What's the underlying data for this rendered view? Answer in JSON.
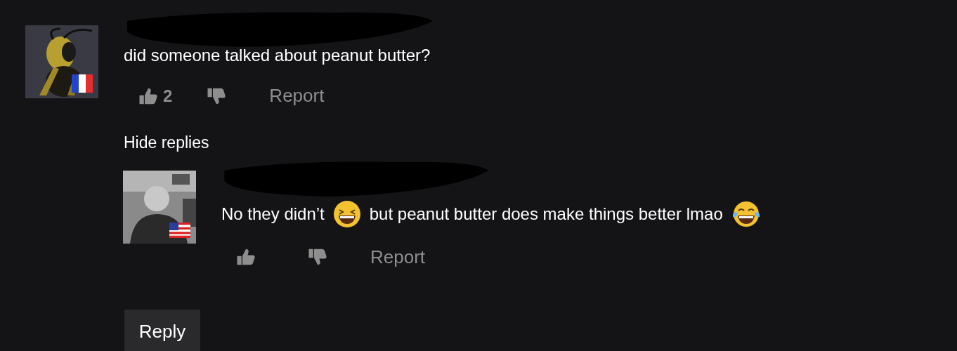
{
  "comments": [
    {
      "flag": {
        "kind": "france"
      },
      "body": [
        {
          "kind": "text",
          "text": "did someone talked about peanut butter?"
        }
      ],
      "likes": "2",
      "report": "Report",
      "toggle": "Hide replies",
      "replies": [
        {
          "flag": {
            "kind": "usa"
          },
          "body": [
            {
              "kind": "text",
              "text": "No they didn’t"
            },
            {
              "kind": "laugh"
            },
            {
              "kind": "text",
              "text": "but peanut butter does make things better lmao"
            },
            {
              "kind": "tears"
            }
          ],
          "report": "Report"
        }
      ]
    }
  ],
  "reply_button": "Reply"
}
